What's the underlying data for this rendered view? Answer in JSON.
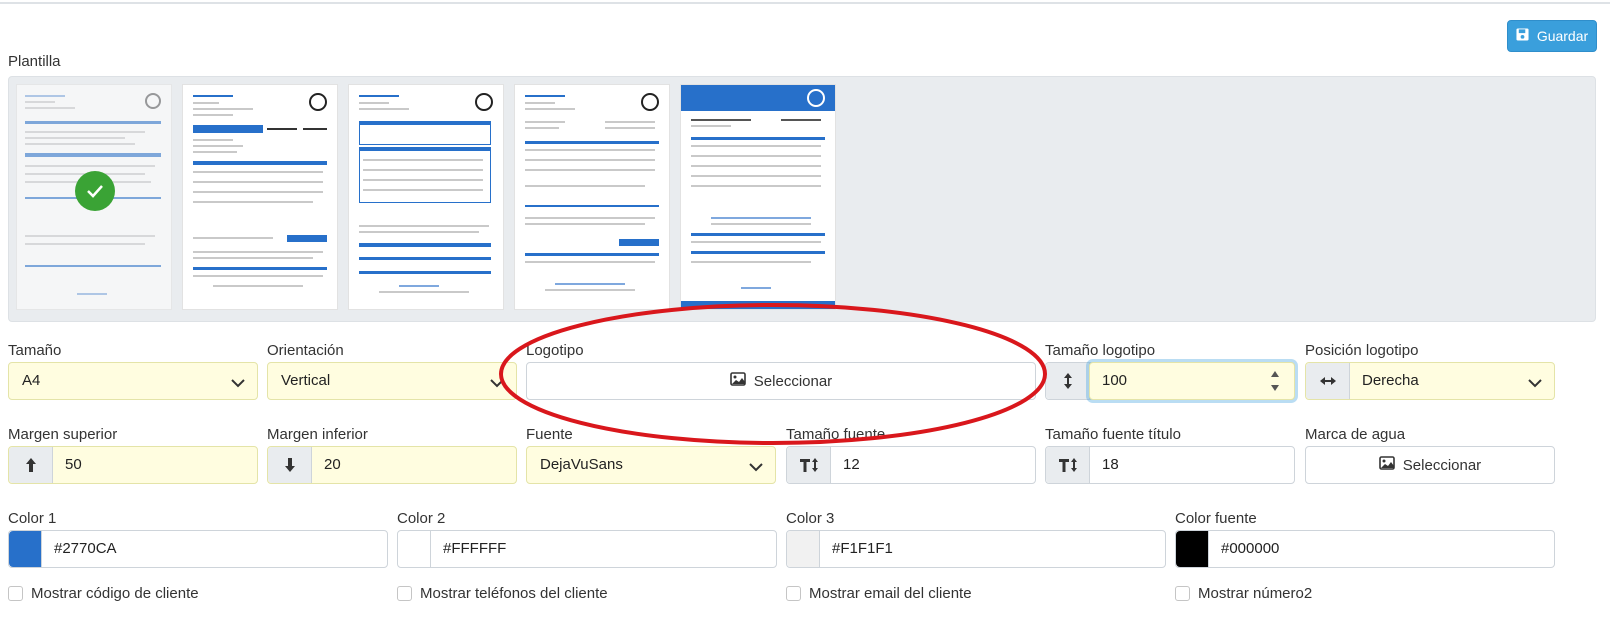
{
  "toolbar": {
    "save_label": "Guardar",
    "save_icon": "floppy-disk-icon"
  },
  "template": {
    "label": "Plantilla",
    "thumbnails": [
      {
        "name": "template-1",
        "selected": true
      },
      {
        "name": "template-2",
        "selected": false
      },
      {
        "name": "template-3",
        "selected": false
      },
      {
        "name": "template-4",
        "selected": false
      },
      {
        "name": "template-5",
        "selected": false
      }
    ]
  },
  "fields": {
    "size": {
      "label": "Tamaño",
      "value": "A4"
    },
    "orientation": {
      "label": "Orientación",
      "value": "Vertical"
    },
    "logo": {
      "label": "Logotipo",
      "button": "Seleccionar"
    },
    "logo_size": {
      "label": "Tamaño logotipo",
      "value": "100"
    },
    "logo_position": {
      "label": "Posición logotipo",
      "value": "Derecha"
    },
    "margin_top": {
      "label": "Margen superior",
      "value": "50"
    },
    "margin_bottom": {
      "label": "Margen inferior",
      "value": "20"
    },
    "font": {
      "label": "Fuente",
      "value": "DejaVuSans"
    },
    "font_size": {
      "label": "Tamaño fuente",
      "value": "12"
    },
    "title_font_size": {
      "label": "Tamaño fuente título",
      "value": "18"
    },
    "watermark": {
      "label": "Marca de agua",
      "button": "Seleccionar"
    }
  },
  "colors": {
    "color1": {
      "label": "Color 1",
      "value": "#2770CA"
    },
    "color2": {
      "label": "Color 2",
      "value": "#FFFFFF"
    },
    "color3": {
      "label": "Color 3",
      "value": "#F1F1F1"
    },
    "font_color": {
      "label": "Color fuente",
      "value": "#000000"
    }
  },
  "checkboxes": [
    {
      "label": "Mostrar código de cliente",
      "checked": false
    },
    {
      "label": "Mostrar teléfonos del cliente",
      "checked": false
    },
    {
      "label": "Mostrar email del cliente",
      "checked": false
    },
    {
      "label": "Mostrar número2",
      "checked": false
    }
  ],
  "annotation": {
    "shape": "red-ellipse",
    "color": "#d9171c"
  }
}
